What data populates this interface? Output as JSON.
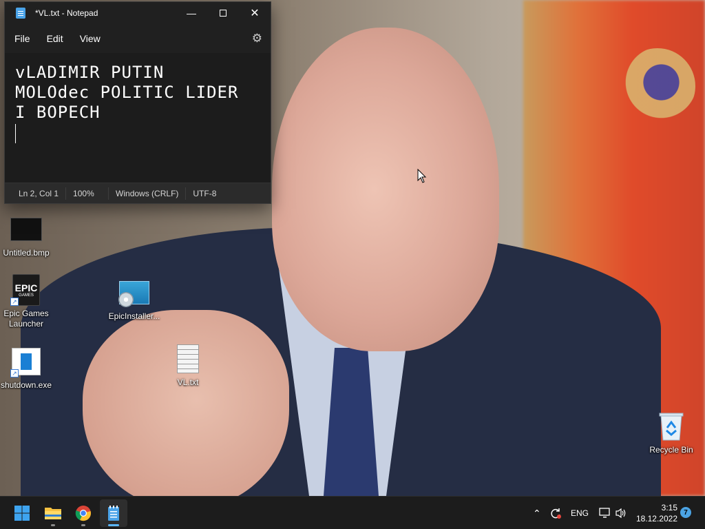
{
  "notepad": {
    "title": "*VL.txt - Notepad",
    "menu": [
      "File",
      "Edit",
      "View"
    ],
    "content_lines": [
      "vLADIMIR PUTIN",
      "MOLOdec POLITIC LIDER",
      "I BOPECH"
    ],
    "status": {
      "position": "Ln 2, Col 1",
      "zoom": "100%",
      "line_ending": "Windows (CRLF)",
      "encoding": "UTF-8"
    }
  },
  "desktop_icons": {
    "untitled_bmp": "Untitled.bmp",
    "epic_launcher": "Epic Games Launcher",
    "epic_installer": "EpicInstaller...",
    "shutdown_exe": "shutdown.exe",
    "vl_txt": "VL.txt",
    "recycle_bin": "Recycle Bin",
    "epic_logo_top": "EPIC",
    "epic_logo_bottom": "GAMES"
  },
  "taskbar": {
    "apps": [
      "start-icon",
      "file-explorer-icon",
      "chrome-icon",
      "notepad-icon"
    ],
    "active_app": "notepad-icon",
    "tray": {
      "language": "ENG",
      "time": "3:15",
      "date": "18.12.2022",
      "notification_count": "7"
    }
  },
  "colors": {
    "taskbar": "#1c1c1c",
    "notepad_bg": "#202020",
    "accent": "#5cb8ff"
  }
}
